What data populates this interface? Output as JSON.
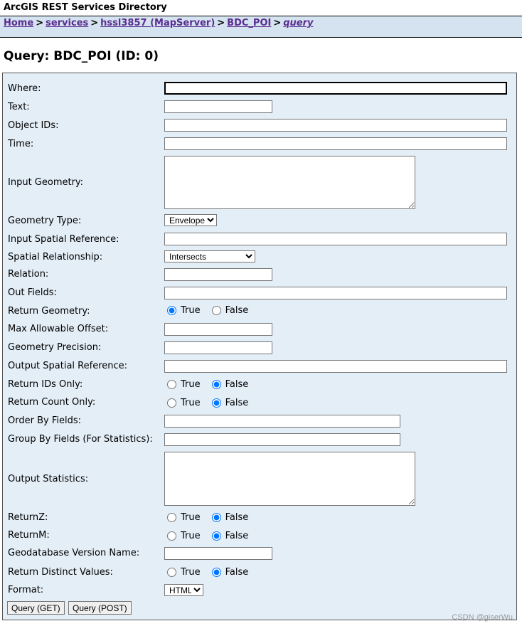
{
  "app_title": "ArcGIS REST Services Directory",
  "breadcrumb": {
    "home": "Home",
    "services": "services",
    "mapserver": "hssl3857 (MapServer)",
    "layer": "BDC_POI",
    "current": "query",
    "separator": ">"
  },
  "page_title": "Query: BDC_POI (ID: 0)",
  "fields": {
    "where": {
      "label": "Where:",
      "value": ""
    },
    "text": {
      "label": "Text:",
      "value": ""
    },
    "object_ids": {
      "label": "Object IDs:",
      "value": ""
    },
    "time": {
      "label": "Time:",
      "value": ""
    },
    "input_geometry": {
      "label": "Input Geometry:",
      "value": ""
    },
    "geometry_type": {
      "label": "Geometry Type:",
      "value": "Envelope"
    },
    "input_spatial_reference": {
      "label": "Input Spatial Reference:",
      "value": ""
    },
    "spatial_relationship": {
      "label": "Spatial Relationship:",
      "value": "Intersects"
    },
    "relation": {
      "label": "Relation:",
      "value": ""
    },
    "out_fields": {
      "label": "Out Fields:",
      "value": ""
    },
    "return_geometry": {
      "label": "Return Geometry:",
      "selected": "True"
    },
    "max_allowable_offset": {
      "label": "Max Allowable Offset:",
      "value": ""
    },
    "geometry_precision": {
      "label": "Geometry Precision:",
      "value": ""
    },
    "output_spatial_reference": {
      "label": "Output Spatial Reference:",
      "value": ""
    },
    "return_ids_only": {
      "label": "Return IDs Only:",
      "selected": "False"
    },
    "return_count_only": {
      "label": "Return Count Only:",
      "selected": "False"
    },
    "order_by_fields": {
      "label": "Order By Fields:",
      "value": ""
    },
    "group_by_fields": {
      "label": "Group By Fields (For Statistics):",
      "value": ""
    },
    "output_statistics": {
      "label": "Output Statistics:",
      "value": ""
    },
    "return_z": {
      "label": "ReturnZ:",
      "selected": "False"
    },
    "return_m": {
      "label": "ReturnM:",
      "selected": "False"
    },
    "gdb_version": {
      "label": "Geodatabase Version Name:",
      "value": ""
    },
    "return_distinct_values": {
      "label": "Return Distinct Values:",
      "selected": "False"
    },
    "format": {
      "label": "Format:",
      "value": "HTML"
    }
  },
  "radio_labels": {
    "true": "True",
    "false": "False"
  },
  "buttons": {
    "get": "Query (GET)",
    "post": "Query (POST)"
  },
  "watermark": "CSDN @giserWu.",
  "colors": {
    "crumb_bg": "#d4e3ef",
    "form_bg": "#e4eef7",
    "link": "#5a2d91",
    "radio_accent": "#0075ff"
  }
}
